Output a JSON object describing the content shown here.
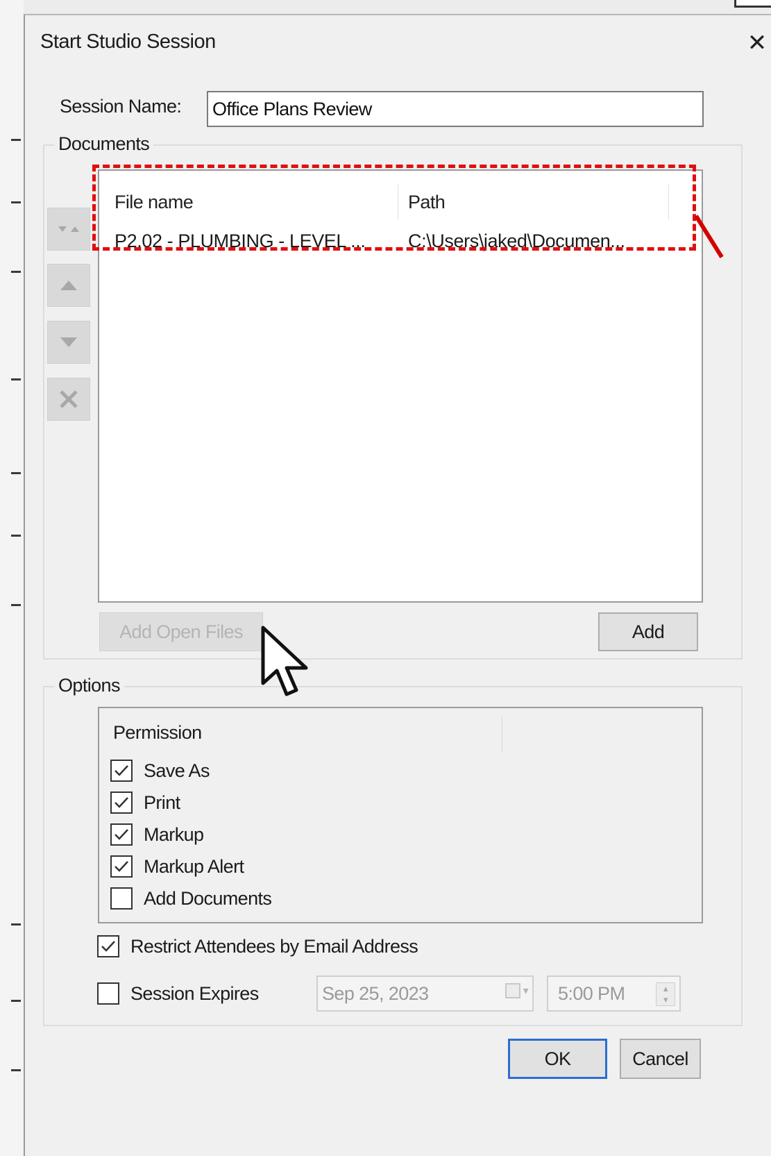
{
  "dialog": {
    "title": "Start Studio Session",
    "close_symbol": "✕"
  },
  "session": {
    "label": "Session Name:",
    "value": "Office Plans Review"
  },
  "documents": {
    "legend": "Documents",
    "columns": [
      "File name",
      "Path"
    ],
    "rows": [
      {
        "file_name": "P2.02 - PLUMBING - LEVEL ...",
        "path": "C:\\Users\\jaked\\Documen..."
      }
    ],
    "side_buttons": [
      "sort-icon",
      "move-up-icon",
      "move-down-icon",
      "remove-icon"
    ],
    "add_open_files_label": "Add Open Files",
    "add_label": "Add"
  },
  "options": {
    "legend": "Options",
    "permission_header": "Permission",
    "permissions": [
      {
        "label": "Save As",
        "checked": true
      },
      {
        "label": "Print",
        "checked": true
      },
      {
        "label": "Markup",
        "checked": true
      },
      {
        "label": "Markup Alert",
        "checked": true
      },
      {
        "label": "Add Documents",
        "checked": false
      }
    ],
    "restrict_label": "Restrict Attendees by Email Address",
    "restrict_checked": true,
    "expires_label": "Session Expires",
    "expires_checked": false,
    "expires_date": "Sep 25, 2023",
    "expires_time": "5:00 PM"
  },
  "footer": {
    "ok_label": "OK",
    "cancel_label": "Cancel"
  },
  "colors": {
    "annotation": "#e01010",
    "default_button_border": "#2a6fd0"
  }
}
